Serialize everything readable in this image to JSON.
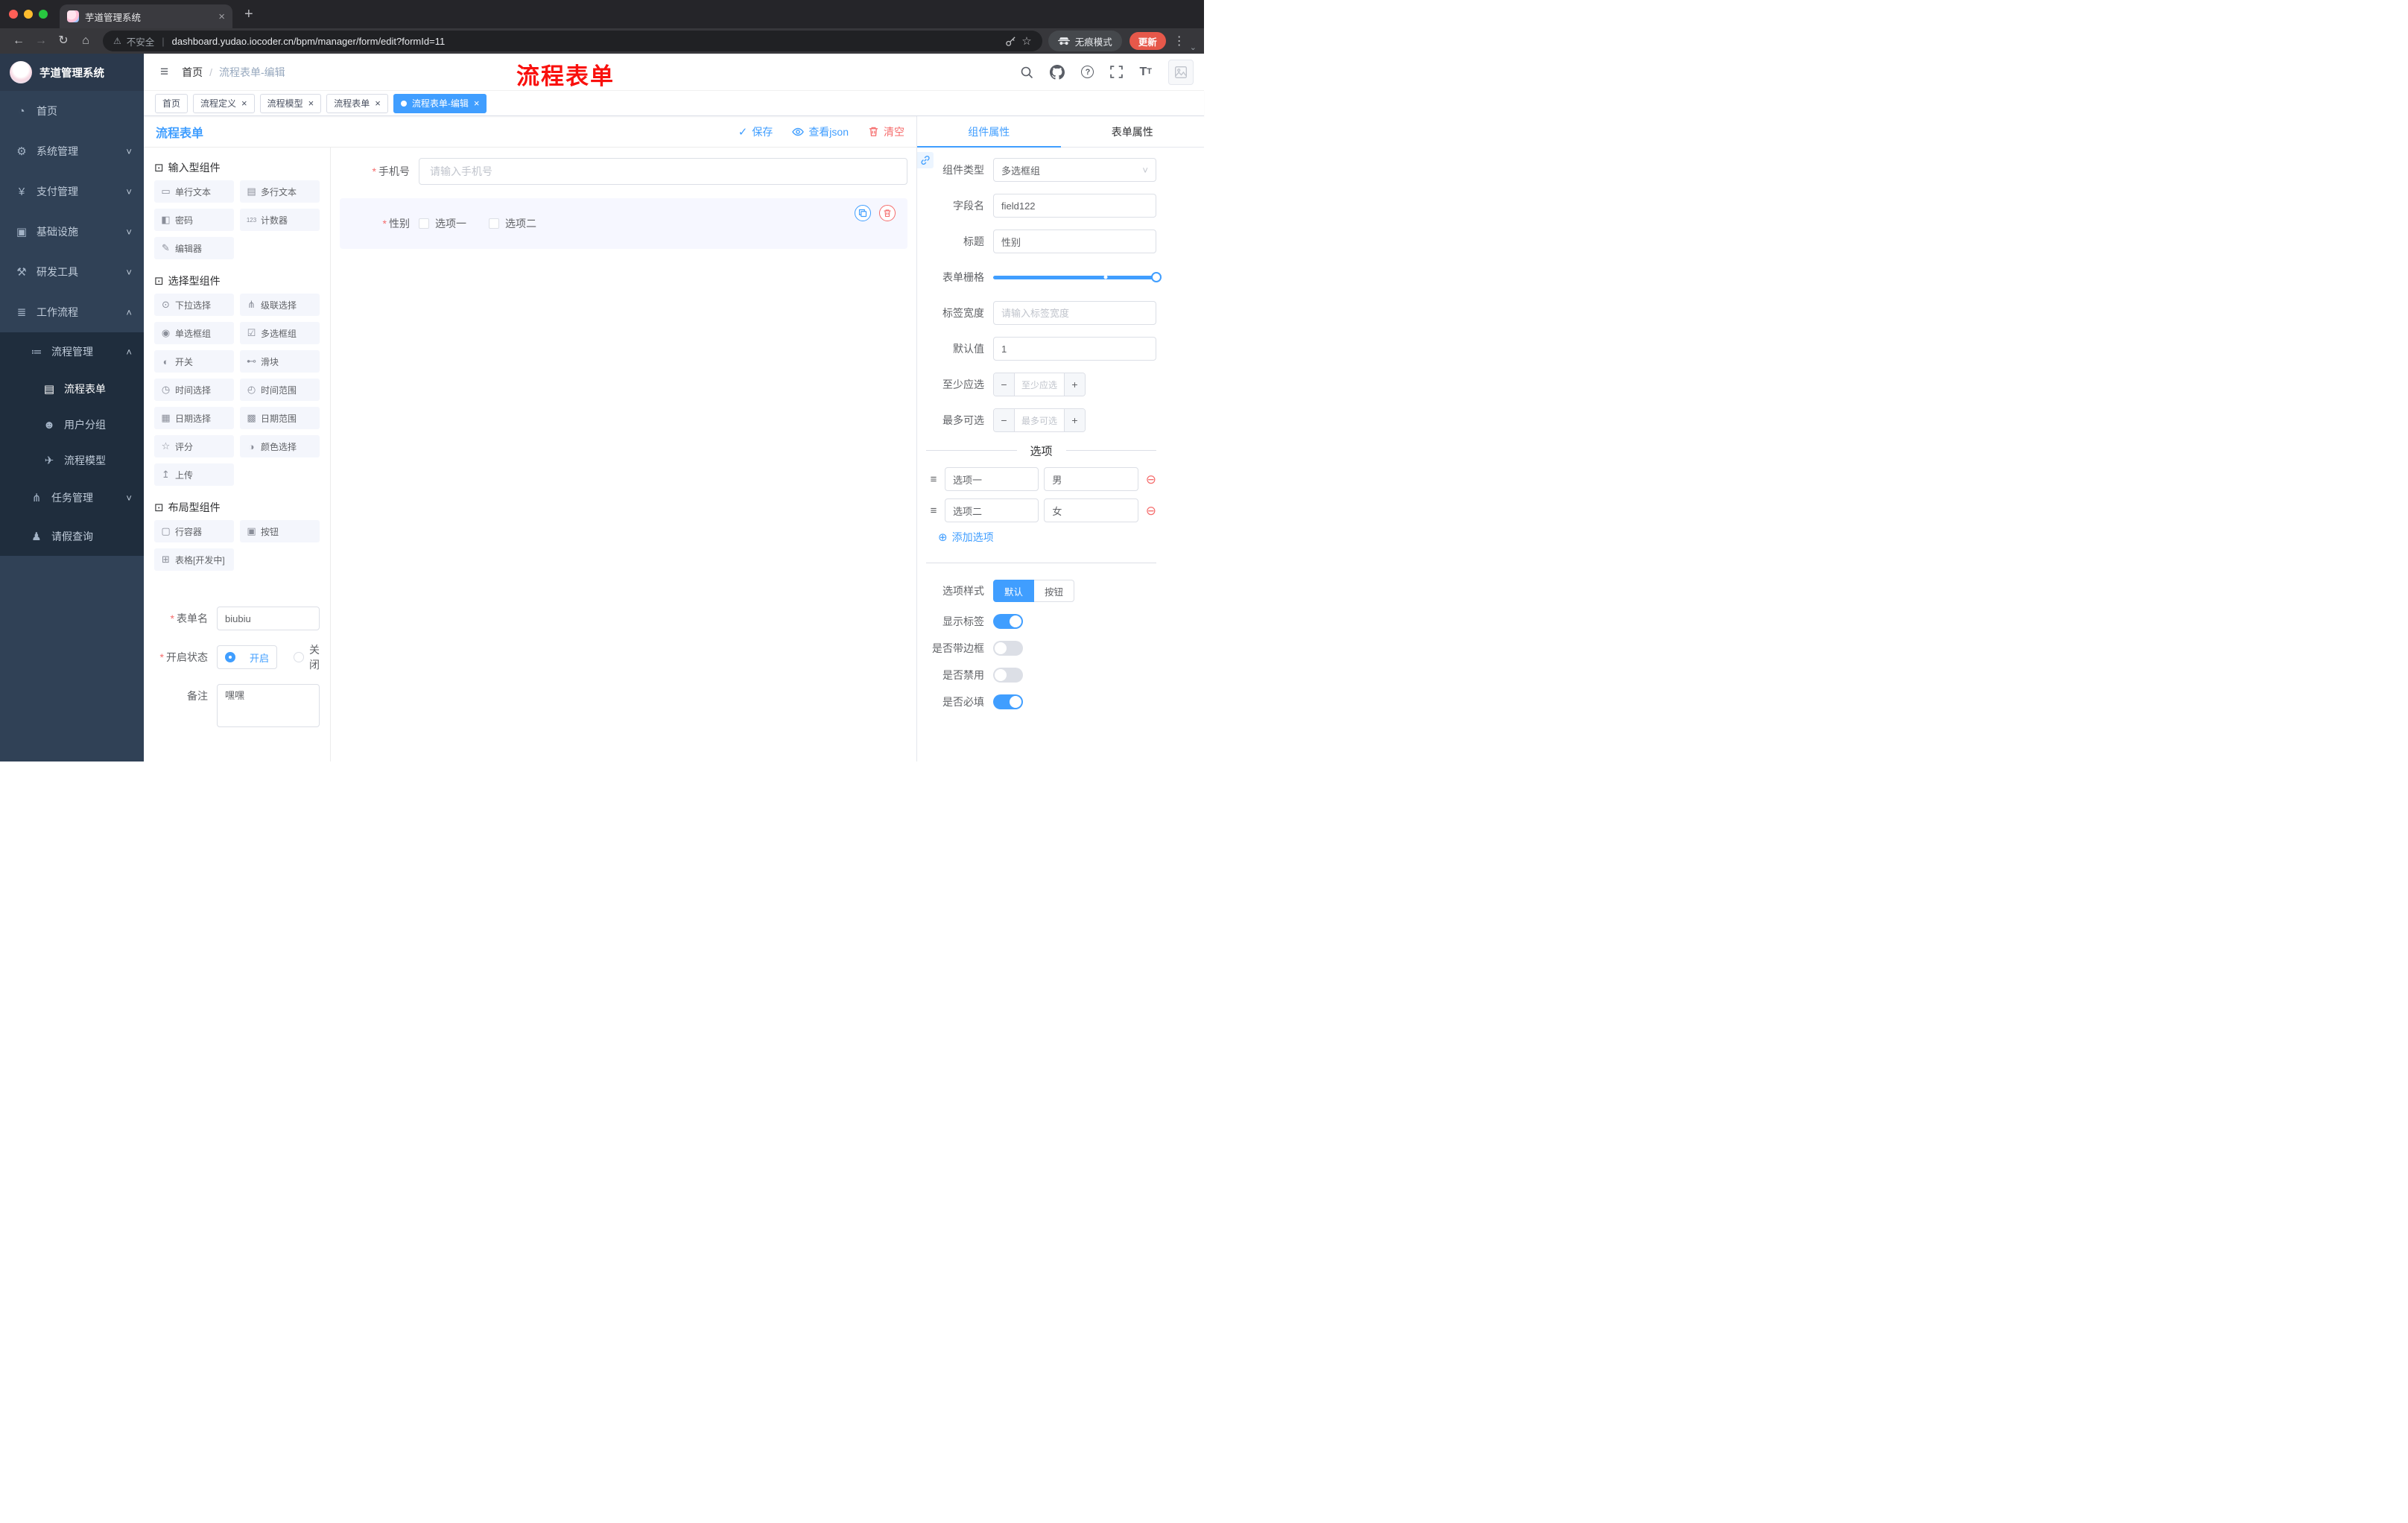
{
  "icon_glyphs": {
    "dashboard-icon": "◔",
    "gear-icon": "⚙",
    "payment-icon": "¥",
    "infrastructure-icon": "▣",
    "devtools-icon": "⚒",
    "workflow-icon": "≣",
    "process-mgmt-icon": "≔",
    "form-icon": "▤",
    "user-group-icon": "☻",
    "model-icon": "✈",
    "task-icon": "⋔",
    "leave-icon": "♟",
    "component-icon": "⊡",
    "input-icon": "▭",
    "textarea-icon": "▤",
    "password-icon": "◧",
    "counter-icon": "123",
    "editor-icon": "✎",
    "select-icon": "⊙",
    "cascader-icon": "⋔",
    "radio-icon": "◉",
    "checkbox-icon": "☑",
    "switch-icon": "◐",
    "slider-icon": "⊷",
    "time-icon": "◷",
    "time-range-icon": "◴",
    "date-icon": "▦",
    "date-range-icon": "▩",
    "rate-icon": "☆",
    "color-icon": "◑",
    "upload-icon": "↥",
    "row-icon": "▢",
    "button-icon": "▣",
    "table-icon": "⊞"
  },
  "browser": {
    "tab_title": "芋道管理系统",
    "security_label": "不安全",
    "url": "dashboard.yudao.iocoder.cn/bpm/manager/form/edit?formId=11",
    "incognito_label": "无痕模式",
    "update_label": "更新"
  },
  "sidebar": {
    "logo_title": "芋道管理系统",
    "menu": [
      {
        "name": "home",
        "label": "首页",
        "icon": "dashboard-icon",
        "level": 0
      },
      {
        "name": "system-mgmt",
        "label": "系统管理",
        "icon": "gear-icon",
        "level": 0,
        "chevron": "down"
      },
      {
        "name": "payment-mgmt",
        "label": "支付管理",
        "icon": "payment-icon",
        "level": 0,
        "chevron": "down"
      },
      {
        "name": "infrastructure",
        "label": "基础设施",
        "icon": "infrastructure-icon",
        "level": 0,
        "chevron": "down"
      },
      {
        "name": "dev-tools",
        "label": "研发工具",
        "icon": "devtools-icon",
        "level": 0,
        "chevron": "down"
      },
      {
        "name": "workflow",
        "label": "工作流程",
        "icon": "workflow-icon",
        "level": 0,
        "chevron": "up"
      },
      {
        "name": "process-mgmt",
        "label": "流程管理",
        "icon": "process-mgmt-icon",
        "level": 1,
        "chevron": "up",
        "sub": true
      },
      {
        "name": "process-form",
        "label": "流程表单",
        "icon": "form-icon",
        "level": 2,
        "active": true,
        "sub": true
      },
      {
        "name": "user-group",
        "label": "用户分组",
        "icon": "user-group-icon",
        "level": 2,
        "sub": true
      },
      {
        "name": "process-model",
        "label": "流程模型",
        "icon": "model-icon",
        "level": 2,
        "sub": true
      },
      {
        "name": "task-mgmt",
        "label": "任务管理",
        "icon": "task-icon",
        "level": 1,
        "chevron": "down",
        "sub": true
      },
      {
        "name": "leave-query",
        "label": "请假查询",
        "icon": "leave-icon",
        "level": 1,
        "sub": true
      }
    ]
  },
  "header": {
    "breadcrumb": [
      "首页",
      "流程表单-编辑"
    ],
    "annotation": "流程表单"
  },
  "tags": [
    {
      "name": "home",
      "label": "首页",
      "closable": false,
      "active": false
    },
    {
      "name": "process-definition",
      "label": "流程定义",
      "closable": true,
      "active": false
    },
    {
      "name": "process-model",
      "label": "流程模型",
      "closable": true,
      "active": false
    },
    {
      "name": "process-form",
      "label": "流程表单",
      "closable": true,
      "active": false
    },
    {
      "name": "process-form-edit",
      "label": "流程表单-编辑",
      "closable": true,
      "active": true
    }
  ],
  "designer": {
    "title": "流程表单",
    "actions": {
      "save": "保存",
      "view_json": "查看json",
      "clear": "清空"
    },
    "palette_groups": [
      {
        "title": "输入型组件",
        "items": [
          {
            "label": "单行文本",
            "icon": "input-icon"
          },
          {
            "label": "多行文本",
            "icon": "textarea-icon"
          },
          {
            "label": "密码",
            "icon": "password-icon"
          },
          {
            "label": "计数器",
            "icon": "counter-icon"
          },
          {
            "label": "编辑器",
            "icon": "editor-icon"
          }
        ]
      },
      {
        "title": "选择型组件",
        "items": [
          {
            "label": "下拉选择",
            "icon": "select-icon"
          },
          {
            "label": "级联选择",
            "icon": "cascader-icon"
          },
          {
            "label": "单选框组",
            "icon": "radio-icon"
          },
          {
            "label": "多选框组",
            "icon": "checkbox-icon"
          },
          {
            "label": "开关",
            "icon": "switch-icon"
          },
          {
            "label": "滑块",
            "icon": "slider-icon"
          },
          {
            "label": "时间选择",
            "icon": "time-icon"
          },
          {
            "label": "时间范围",
            "icon": "time-range-icon"
          },
          {
            "label": "日期选择",
            "icon": "date-icon"
          },
          {
            "label": "日期范围",
            "icon": "date-range-icon"
          },
          {
            "label": "评分",
            "icon": "rate-icon"
          },
          {
            "label": "颜色选择",
            "icon": "color-icon"
          },
          {
            "label": "上传",
            "icon": "upload-icon"
          }
        ]
      },
      {
        "title": "布局型组件",
        "items": [
          {
            "label": "行容器",
            "icon": "row-icon"
          },
          {
            "label": "按钮",
            "icon": "button-icon"
          },
          {
            "label": "表格[开发中]",
            "icon": "table-icon"
          }
        ]
      }
    ],
    "form": {
      "name_label": "表单名",
      "name_value": "biubiu",
      "status_label": "开启状态",
      "status_on": "开启",
      "status_off": "关闭",
      "remark_label": "备注",
      "remark_value": "嘿嘿"
    }
  },
  "canvas": {
    "phone": {
      "label": "手机号",
      "placeholder": "请输入手机号"
    },
    "gender": {
      "label": "性别",
      "options": [
        "选项一",
        "选项二"
      ]
    }
  },
  "props": {
    "tabs": [
      {
        "name": "component-props",
        "label": "组件属性",
        "active": true
      },
      {
        "name": "form-props",
        "label": "表单属性",
        "active": false
      }
    ],
    "rows": {
      "component_type": {
        "label": "组件类型",
        "value": "多选框组"
      },
      "field_name": {
        "label": "字段名",
        "value": "field122"
      },
      "title": {
        "label": "标题",
        "value": "性别"
      },
      "grid": {
        "label": "表单栅格"
      },
      "label_width": {
        "label": "标签宽度",
        "placeholder": "请输入标签宽度"
      },
      "default_value": {
        "label": "默认值",
        "value": "1"
      },
      "min_select": {
        "label": "至少应选",
        "placeholder": "至少应选"
      },
      "max_select": {
        "label": "最多可选",
        "placeholder": "最多可选"
      },
      "option_style": {
        "label": "选项样式",
        "options": [
          "默认",
          "按钮"
        ],
        "selected": "默认"
      }
    },
    "options_section": {
      "title": "选项",
      "rows": [
        {
          "name": "选项一",
          "value": "男"
        },
        {
          "name": "选项二",
          "value": "女"
        }
      ],
      "add_label": "添加选项"
    },
    "switches": [
      {
        "name": "show-label",
        "label": "显示标签",
        "on": true
      },
      {
        "name": "with-border",
        "label": "是否带边框",
        "on": false
      },
      {
        "name": "disabled",
        "label": "是否禁用",
        "on": false
      },
      {
        "name": "required",
        "label": "是否必填",
        "on": true
      }
    ]
  }
}
